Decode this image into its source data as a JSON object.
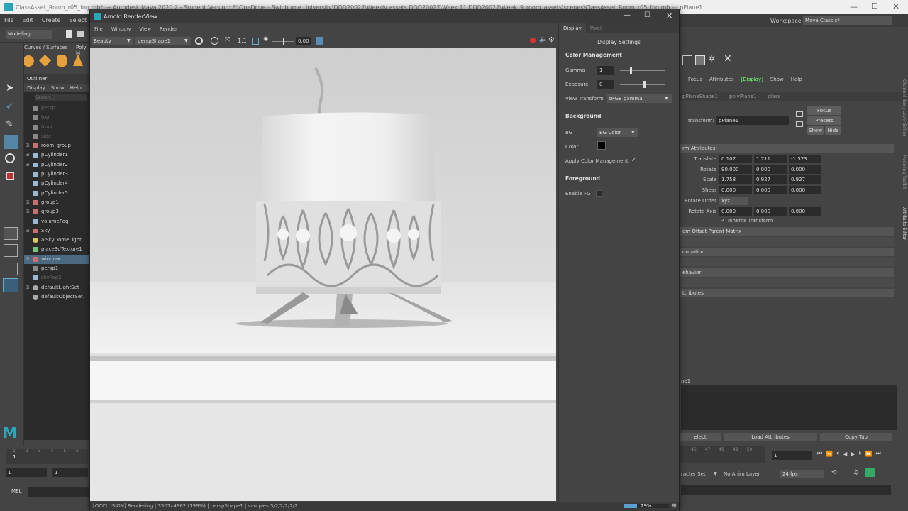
{
  "maya": {
    "title": "ClassAsset_Room_r05_fog.mb* --- Autodesk Maya 2020.2 - Student Version: F:\\OneDrive - Swinburne University\\DDD20027\\Weekly assets DDD20027\\Week 11 DDD20027\\Week_9_room_assets\\scenes\\ClassAsset_Room_r05_fog.mb --- pPlane1",
    "menu": [
      "File",
      "Edit",
      "Create",
      "Select",
      "Mo"
    ],
    "workspace_label": "Workspace :",
    "workspace_value": "Maya Classic*",
    "mode": "Modeling",
    "shelf_tabs": [
      "Curves / Surfaces",
      "Poly M"
    ],
    "outliner": {
      "title": "Outliner",
      "menu": [
        "Display",
        "Show",
        "Help"
      ],
      "search_placeholder": "Search...",
      "items": [
        {
          "label": "persp",
          "dim": true,
          "expander": "",
          "icon": "camera"
        },
        {
          "label": "top",
          "dim": true,
          "expander": "",
          "icon": "camera"
        },
        {
          "label": "front",
          "dim": true,
          "expander": "",
          "icon": "camera"
        },
        {
          "label": "side",
          "dim": true,
          "expander": "",
          "icon": "camera"
        },
        {
          "label": "room_group",
          "dim": false,
          "expander": "⊞",
          "icon": "group"
        },
        {
          "label": "pCylinder1",
          "dim": false,
          "expander": "⊞",
          "icon": "mesh"
        },
        {
          "label": "pCylinder2",
          "dim": false,
          "expander": "⊞",
          "icon": "mesh"
        },
        {
          "label": "pCylinder3",
          "dim": false,
          "expander": "",
          "icon": "mesh"
        },
        {
          "label": "pCylinder4",
          "dim": false,
          "expander": "",
          "icon": "mesh"
        },
        {
          "label": "pCylinder5",
          "dim": false,
          "expander": "",
          "icon": "mesh"
        },
        {
          "label": "group1",
          "dim": false,
          "expander": "⊞",
          "icon": "group"
        },
        {
          "label": "group3",
          "dim": false,
          "expander": "⊞",
          "icon": "group"
        },
        {
          "label": "volumeFog",
          "dim": false,
          "expander": "",
          "icon": "mesh"
        },
        {
          "label": "Sky",
          "dim": false,
          "expander": "⊞",
          "icon": "group"
        },
        {
          "label": "aiSkyDomeLight",
          "dim": false,
          "expander": "",
          "icon": "light"
        },
        {
          "label": "place3dTexture1",
          "dim": false,
          "expander": "",
          "icon": "texture"
        },
        {
          "label": "window",
          "dim": false,
          "expander": "⊞",
          "icon": "group",
          "selected": true
        },
        {
          "label": "persp1",
          "dim": false,
          "expander": "",
          "icon": "camera"
        },
        {
          "label": "skyFog2",
          "dim": true,
          "expander": "",
          "icon": "mesh"
        },
        {
          "label": "defaultLightSet",
          "dim": false,
          "expander": "⊞",
          "icon": "set"
        },
        {
          "label": "defaultObjectSet",
          "dim": false,
          "expander": "",
          "icon": "set"
        }
      ]
    },
    "timeline": {
      "ticks": [
        "1",
        "2",
        "3",
        "4",
        "5",
        "6"
      ],
      "start": "1",
      "end": "1",
      "current": "1"
    },
    "mel_label": "MEL"
  },
  "attr_editor": {
    "menu": [
      "Focus",
      "Attributes",
      "Display",
      "Show",
      "Help"
    ],
    "tabs": [
      "pPlaneShape1",
      "polyPlane1",
      "glass"
    ],
    "transform_label": "transform:",
    "transform_value": "pPlane1",
    "focus": "Focus",
    "presets": "Presets",
    "show": "Show",
    "hide": "Hide",
    "section_transform": "rm Attributes",
    "rows": [
      {
        "label": "Translate",
        "values": [
          "0.107",
          "1.711",
          "-1.573"
        ]
      },
      {
        "label": "Rotate",
        "values": [
          "90.000",
          "0.000",
          "0.000"
        ]
      },
      {
        "label": "Scale",
        "values": [
          "1.758",
          "0.927",
          "0.927"
        ]
      },
      {
        "label": "Shear",
        "values": [
          "0.000",
          "0.000",
          "0.000"
        ]
      }
    ],
    "rotate_order_label": "Rotate Order",
    "rotate_order": "xyz",
    "rotate_axis_label": "Rotate Axis",
    "rotate_axis": [
      "0.000",
      "0.000",
      "0.000"
    ],
    "inherits": "Inherits Transform",
    "sections": [
      "em Offset Parent Matrix",
      "ormation",
      "ehavior",
      "ttributes"
    ],
    "notes_label": "ne1",
    "bottom_buttons": [
      "elect",
      "Load Attributes",
      "Copy Tab"
    ],
    "timeline_ticks": [
      "46",
      "47",
      "48",
      "49",
      "50"
    ],
    "frame": "1",
    "character_set": "racter Set",
    "anim_layer": "No Anim Layer",
    "fps": "24 fps"
  },
  "side_tabs": [
    "Channel Box / Layer Editor",
    "Modeling Toolkit",
    "Attribute Editor"
  ],
  "arnold": {
    "title": "Arnold RenderView",
    "menu": [
      "File",
      "Window",
      "View",
      "Render"
    ],
    "aov": "Beauty",
    "camera": "perspShape1",
    "ratio": "1:1",
    "exposure_value": "0.00",
    "status": "[OCCLUSION] Rendering | 3507x4962 (199%) | perspShape1 | samples 3/2/2/2/2/2",
    "progress_text": "29%",
    "progress": 0.29,
    "panel_tabs": [
      "Display",
      "Pixel"
    ],
    "display_settings": {
      "title": "Display Settings",
      "color_management": "Color Management",
      "gamma_label": "Gamma",
      "gamma": "1",
      "exposure_label": "Exposure",
      "exposure": "0",
      "view_transform_label": "View Transform",
      "view_transform": "sRGB gamma",
      "background": "Background",
      "bg_label": "BG",
      "bg_value": "BG Color",
      "color_label": "Color",
      "apply_cm": "Apply Color Management",
      "foreground": "Foreground",
      "enable_fg": "Enable FG"
    }
  }
}
